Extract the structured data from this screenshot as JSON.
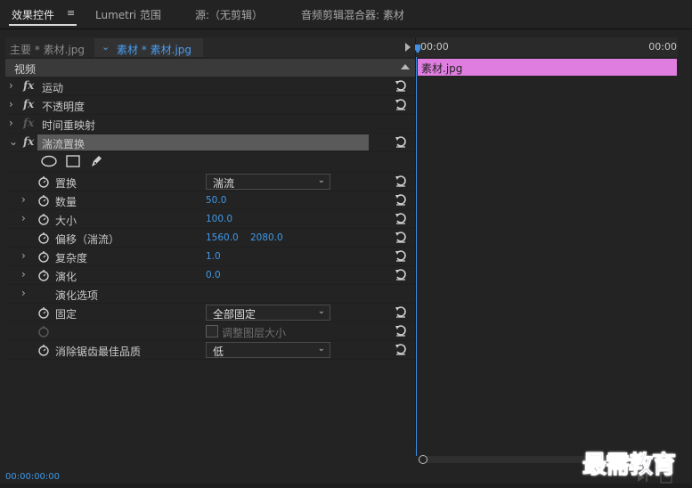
{
  "tabs": [
    {
      "label": "效果控件",
      "active": true
    },
    {
      "label": "Lumetri 范围",
      "active": false
    },
    {
      "label": "源:（无剪辑）",
      "active": false
    },
    {
      "label": "音频剪辑混合器: 素材",
      "active": false
    }
  ],
  "tab_menu_icon": "hamburger-menu-icon",
  "clip_bar": {
    "main_label": "主要 * 素材.jpg",
    "selected_label": "素材 * 素材.jpg"
  },
  "video_section": {
    "label": "视频"
  },
  "effects": [
    {
      "label": "运动",
      "fx_enabled": true
    },
    {
      "label": "不透明度",
      "fx_enabled": true
    },
    {
      "label": "时间重映射",
      "fx_enabled": false
    },
    {
      "label": "湍流置换",
      "fx_enabled": true,
      "expanded": true,
      "selected": true
    }
  ],
  "mask_tools": [
    "ellipse-mask-icon",
    "rectangle-mask-icon",
    "pen-mask-icon"
  ],
  "params": {
    "displace": {
      "label": "置换",
      "value": "湍流"
    },
    "amount": {
      "label": "数量",
      "value": "50.0"
    },
    "size": {
      "label": "大小",
      "value": "100.0"
    },
    "offset": {
      "label": "偏移（湍流）",
      "value_x": "1560.0",
      "value_y": "2080.0"
    },
    "complexity": {
      "label": "复杂度",
      "value": "1.0"
    },
    "evolution": {
      "label": "演化",
      "value": "0.0"
    },
    "evolution_options": {
      "label": "演化选项"
    },
    "pinning": {
      "label": "固定",
      "value": "全部固定"
    },
    "resize_layer": {
      "label": "调整图层大小",
      "checked": false
    },
    "antialiasing": {
      "label": "消除锯齿最佳品质",
      "value": "低"
    }
  },
  "timeline": {
    "ruler_start": "00:00",
    "ruler_end": "00:00",
    "clip_label": "素材.jpg",
    "clip_color": "#e07de0"
  },
  "timecode": "00:00:00:00",
  "watermark": "最需教育",
  "colors": {
    "accent": "#3f99e8",
    "background": "#232323"
  }
}
